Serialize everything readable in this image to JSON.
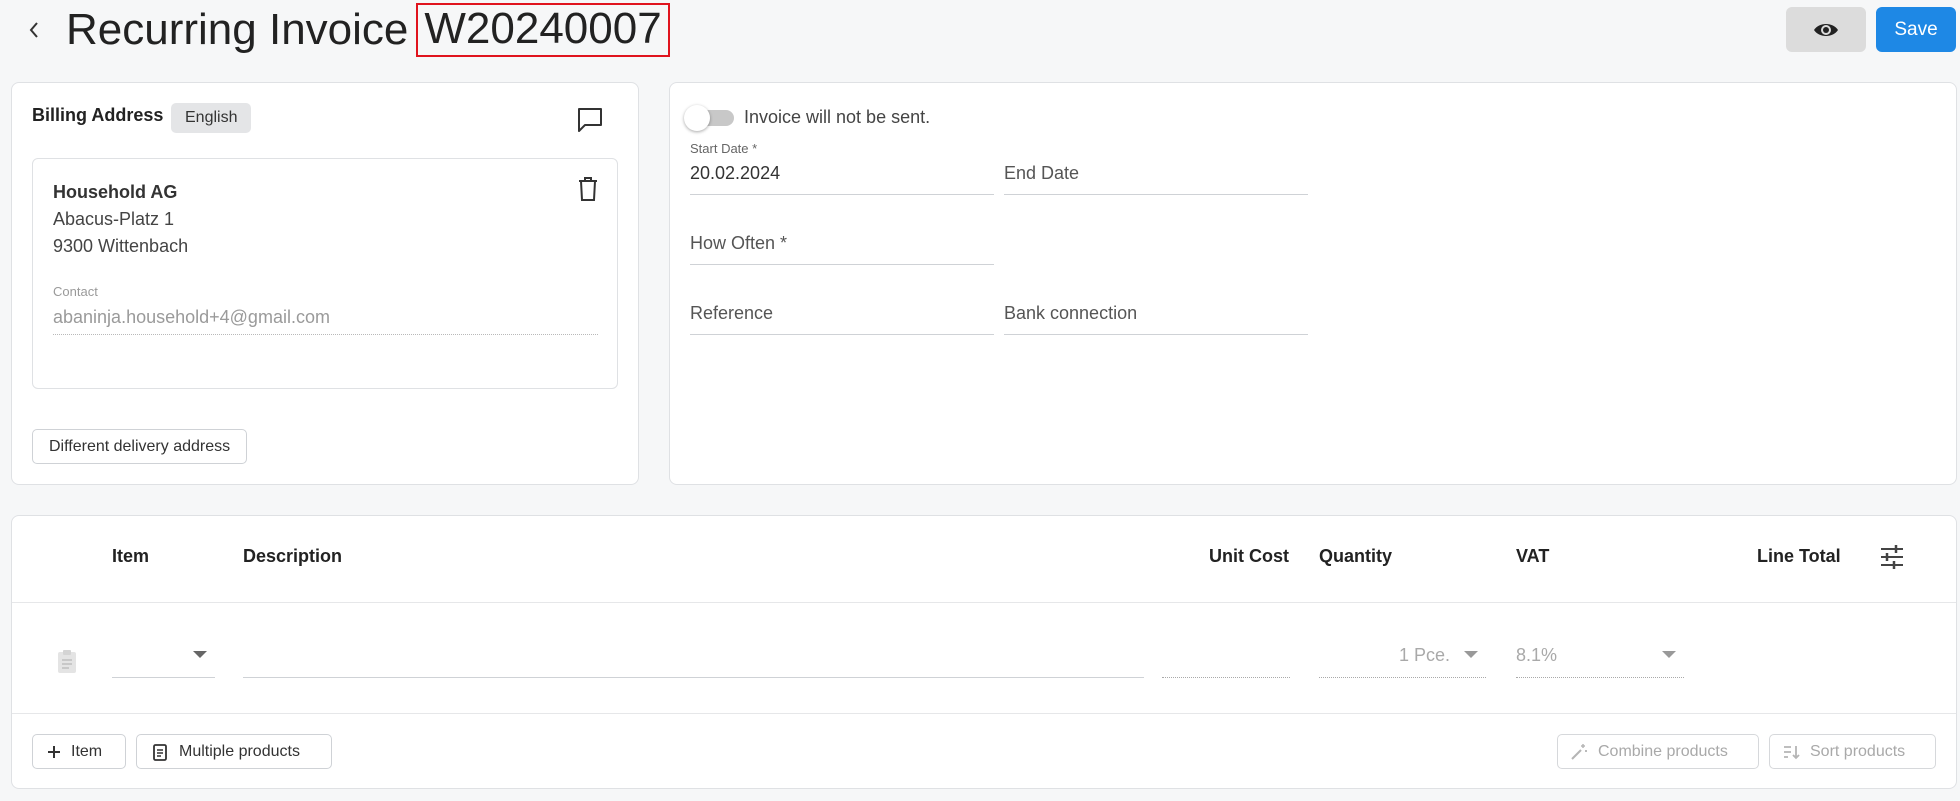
{
  "header": {
    "title": "Recurring Invoice",
    "document_number": "W20240007",
    "save_label": "Save"
  },
  "billing": {
    "title": "Billing Address",
    "language": "English",
    "address": {
      "name": "Household AG",
      "line1": "Abacus-Platz 1",
      "line2": "9300 Wittenbach"
    },
    "contact_label": "Contact",
    "contact_value": "abaninja.household+4@gmail.com",
    "delivery_button": "Different delivery address"
  },
  "settings": {
    "send_toggle_label": "Invoice will not be sent.",
    "send_enabled": false,
    "start_date_label": "Start Date *",
    "start_date_value": "20.02.2024",
    "end_date_placeholder": "End Date",
    "how_often_placeholder": "How Often *",
    "reference_placeholder": "Reference",
    "bank_connection_placeholder": "Bank connection"
  },
  "items": {
    "columns": {
      "item": "Item",
      "description": "Description",
      "unit_cost": "Unit Cost",
      "quantity": "Quantity",
      "vat": "VAT",
      "line_total": "Line Total"
    },
    "row": {
      "quantity": "1 Pce.",
      "vat": "8.1%"
    },
    "buttons": {
      "add_item": "Item",
      "multiple_products": "Multiple products",
      "combine_products": "Combine products",
      "sort_products": "Sort products"
    }
  },
  "colors": {
    "primary": "#1e88e5",
    "highlight_border": "#e0141e",
    "muted_text": "#a9a9a9"
  }
}
